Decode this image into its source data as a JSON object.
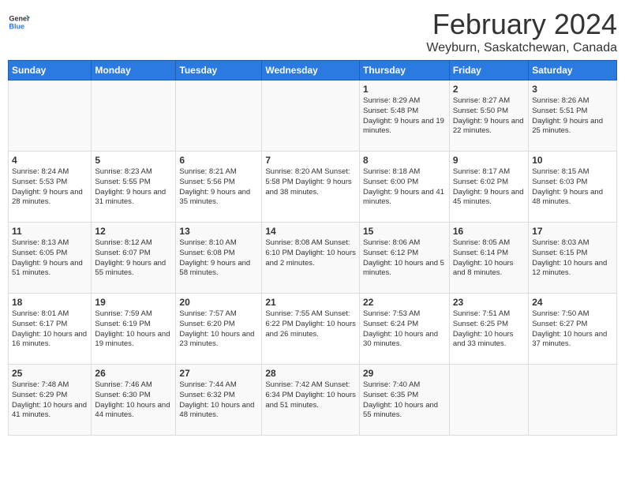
{
  "header": {
    "logo_general": "General",
    "logo_blue": "Blue",
    "title": "February 2024",
    "subtitle": "Weyburn, Saskatchewan, Canada"
  },
  "days_of_week": [
    "Sunday",
    "Monday",
    "Tuesday",
    "Wednesday",
    "Thursday",
    "Friday",
    "Saturday"
  ],
  "weeks": [
    [
      {
        "num": "",
        "info": ""
      },
      {
        "num": "",
        "info": ""
      },
      {
        "num": "",
        "info": ""
      },
      {
        "num": "",
        "info": ""
      },
      {
        "num": "1",
        "info": "Sunrise: 8:29 AM\nSunset: 5:48 PM\nDaylight: 9 hours and 19 minutes."
      },
      {
        "num": "2",
        "info": "Sunrise: 8:27 AM\nSunset: 5:50 PM\nDaylight: 9 hours and 22 minutes."
      },
      {
        "num": "3",
        "info": "Sunrise: 8:26 AM\nSunset: 5:51 PM\nDaylight: 9 hours and 25 minutes."
      }
    ],
    [
      {
        "num": "4",
        "info": "Sunrise: 8:24 AM\nSunset: 5:53 PM\nDaylight: 9 hours and 28 minutes."
      },
      {
        "num": "5",
        "info": "Sunrise: 8:23 AM\nSunset: 5:55 PM\nDaylight: 9 hours and 31 minutes."
      },
      {
        "num": "6",
        "info": "Sunrise: 8:21 AM\nSunset: 5:56 PM\nDaylight: 9 hours and 35 minutes."
      },
      {
        "num": "7",
        "info": "Sunrise: 8:20 AM\nSunset: 5:58 PM\nDaylight: 9 hours and 38 minutes."
      },
      {
        "num": "8",
        "info": "Sunrise: 8:18 AM\nSunset: 6:00 PM\nDaylight: 9 hours and 41 minutes."
      },
      {
        "num": "9",
        "info": "Sunrise: 8:17 AM\nSunset: 6:02 PM\nDaylight: 9 hours and 45 minutes."
      },
      {
        "num": "10",
        "info": "Sunrise: 8:15 AM\nSunset: 6:03 PM\nDaylight: 9 hours and 48 minutes."
      }
    ],
    [
      {
        "num": "11",
        "info": "Sunrise: 8:13 AM\nSunset: 6:05 PM\nDaylight: 9 hours and 51 minutes."
      },
      {
        "num": "12",
        "info": "Sunrise: 8:12 AM\nSunset: 6:07 PM\nDaylight: 9 hours and 55 minutes."
      },
      {
        "num": "13",
        "info": "Sunrise: 8:10 AM\nSunset: 6:08 PM\nDaylight: 9 hours and 58 minutes."
      },
      {
        "num": "14",
        "info": "Sunrise: 8:08 AM\nSunset: 6:10 PM\nDaylight: 10 hours and 2 minutes."
      },
      {
        "num": "15",
        "info": "Sunrise: 8:06 AM\nSunset: 6:12 PM\nDaylight: 10 hours and 5 minutes."
      },
      {
        "num": "16",
        "info": "Sunrise: 8:05 AM\nSunset: 6:14 PM\nDaylight: 10 hours and 8 minutes."
      },
      {
        "num": "17",
        "info": "Sunrise: 8:03 AM\nSunset: 6:15 PM\nDaylight: 10 hours and 12 minutes."
      }
    ],
    [
      {
        "num": "18",
        "info": "Sunrise: 8:01 AM\nSunset: 6:17 PM\nDaylight: 10 hours and 16 minutes."
      },
      {
        "num": "19",
        "info": "Sunrise: 7:59 AM\nSunset: 6:19 PM\nDaylight: 10 hours and 19 minutes."
      },
      {
        "num": "20",
        "info": "Sunrise: 7:57 AM\nSunset: 6:20 PM\nDaylight: 10 hours and 23 minutes."
      },
      {
        "num": "21",
        "info": "Sunrise: 7:55 AM\nSunset: 6:22 PM\nDaylight: 10 hours and 26 minutes."
      },
      {
        "num": "22",
        "info": "Sunrise: 7:53 AM\nSunset: 6:24 PM\nDaylight: 10 hours and 30 minutes."
      },
      {
        "num": "23",
        "info": "Sunrise: 7:51 AM\nSunset: 6:25 PM\nDaylight: 10 hours and 33 minutes."
      },
      {
        "num": "24",
        "info": "Sunrise: 7:50 AM\nSunset: 6:27 PM\nDaylight: 10 hours and 37 minutes."
      }
    ],
    [
      {
        "num": "25",
        "info": "Sunrise: 7:48 AM\nSunset: 6:29 PM\nDaylight: 10 hours and 41 minutes."
      },
      {
        "num": "26",
        "info": "Sunrise: 7:46 AM\nSunset: 6:30 PM\nDaylight: 10 hours and 44 minutes."
      },
      {
        "num": "27",
        "info": "Sunrise: 7:44 AM\nSunset: 6:32 PM\nDaylight: 10 hours and 48 minutes."
      },
      {
        "num": "28",
        "info": "Sunrise: 7:42 AM\nSunset: 6:34 PM\nDaylight: 10 hours and 51 minutes."
      },
      {
        "num": "29",
        "info": "Sunrise: 7:40 AM\nSunset: 6:35 PM\nDaylight: 10 hours and 55 minutes."
      },
      {
        "num": "",
        "info": ""
      },
      {
        "num": "",
        "info": ""
      }
    ]
  ]
}
